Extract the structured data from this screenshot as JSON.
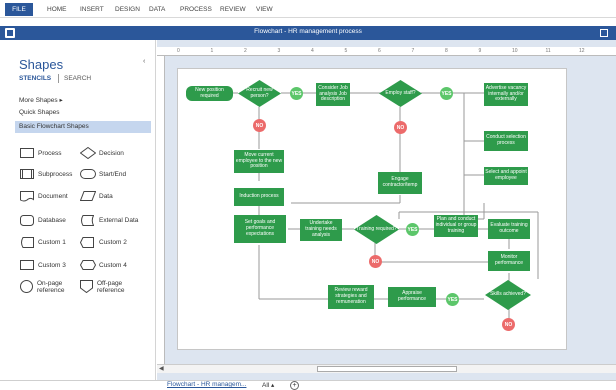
{
  "ribbon": {
    "file": "FILE",
    "tabs": [
      "HOME",
      "INSERT",
      "DESIGN",
      "DATA",
      "PROCESS",
      "REVIEW",
      "VIEW"
    ]
  },
  "window": {
    "title": "Flowchart - HR management process"
  },
  "shapes_pane": {
    "title": "Shapes",
    "tabs": {
      "stencils": "STENCILS",
      "search": "SEARCH"
    },
    "menu": {
      "more_shapes": "More Shapes",
      "quick_shapes": "Quick Shapes",
      "basic_flowchart": "Basic Flowchart Shapes"
    },
    "items": [
      "Process",
      "Decision",
      "Subprocess",
      "Start/End",
      "Document",
      "Data",
      "Database",
      "External Data",
      "Custom 1",
      "Custom 2",
      "Custom 3",
      "Custom 4",
      "On-page reference",
      "Off-page reference"
    ]
  },
  "ruler": {
    "marks": [
      "0",
      "1",
      "2",
      "3",
      "4",
      "5",
      "6",
      "7",
      "8",
      "9",
      "10",
      "11",
      "12"
    ]
  },
  "flowchart": {
    "new_position": "New position required",
    "recruit": "Recruit new person?",
    "consider": "Consider Job analysis Job description",
    "employ_staff": "Employ staff?",
    "advertise": "Advertise vacancy internally and/or externally",
    "conduct_selection": "Conduct selection process",
    "select_appoint": "Select and appoint employee",
    "move_current": "Move current employee to the new position",
    "engage": "Engage contractor/temp",
    "induction": "Induction process",
    "set_goals": "Set goals and performance expectations",
    "undertake": "Undertake training needs analysis",
    "training_required": "Training required?",
    "plan_conduct": "Plan and conduct individual or group training",
    "evaluate": "Evaluate training outcome",
    "monitor": "Monitor performance",
    "review_reward": "Review reward strategies and remuneration",
    "appraise": "Appraise performance",
    "skills": "Skills achieved?",
    "yes": "YES",
    "no": "NO"
  },
  "sheet_bar": {
    "tab": "Flowchart - HR managem...",
    "all": "All ▴",
    "add": "+"
  }
}
